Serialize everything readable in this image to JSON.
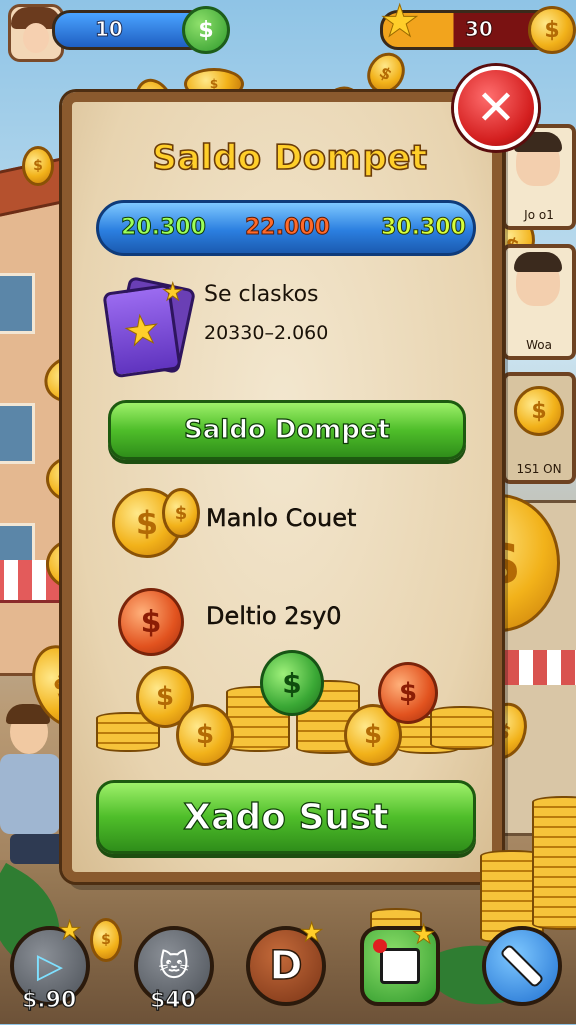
{
  "top_bar": {
    "left_value": "10",
    "right_value": "30"
  },
  "side_cards": [
    {
      "label": "Jo o1"
    },
    {
      "label": "Woa"
    },
    {
      "label": "1S1 ON"
    }
  ],
  "dialog": {
    "title": "Saldo Dompet",
    "balances": [
      "20.300",
      "22.000",
      "30.300"
    ],
    "info_line1": "Se claskos",
    "info_line2": "20330–2.060",
    "primary_button": "Saldo Dompet",
    "row1_label": "Manlo Couet",
    "row2_label": "Deltio 2sy0",
    "bottom_button": "Xado Sust",
    "close_symbol": "✕"
  },
  "bottom_nav": [
    {
      "icon": "play-icon",
      "label": "$.90"
    },
    {
      "icon": "cat-icon",
      "label": "$40"
    },
    {
      "icon": "d-letter-icon",
      "letter": "D"
    },
    {
      "icon": "inbox-icon"
    },
    {
      "icon": "wand-icon"
    }
  ],
  "colors": {
    "title_gold": "#ffcf2a",
    "balance_green": "#7cff3a",
    "balance_red": "#ff5a2a",
    "balance_lime": "#c8ff3a",
    "button_green": "#4fbe2a",
    "close_red": "#d41f1f"
  }
}
